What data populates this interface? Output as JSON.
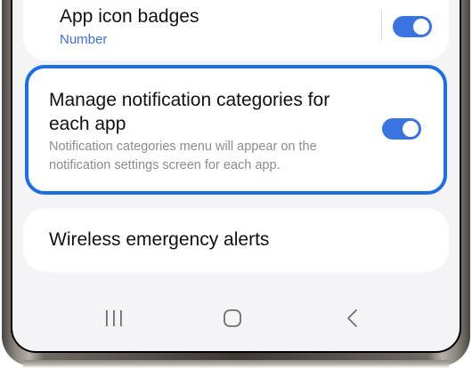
{
  "settings": {
    "app_icon_badges": {
      "title": "App icon badges",
      "value": "Number",
      "enabled": true
    },
    "manage_categories": {
      "title_line1": "Manage notification categories for",
      "title_line2": "each app",
      "description_line1": "Notification categories menu will appear on the",
      "description_line2": "notification settings screen for each app.",
      "enabled": true,
      "highlighted": true
    },
    "wireless_alerts": {
      "title": "Wireless emergency alerts"
    }
  },
  "nav_bar": {
    "buttons": [
      "recent-apps-icon",
      "home-icon",
      "back-icon"
    ]
  },
  "colors": {
    "accent": "#3a74e0",
    "highlight_border": "#1b6fe3",
    "subtitle_blue": "#3e6fd8",
    "background": "#f4f4f6"
  }
}
